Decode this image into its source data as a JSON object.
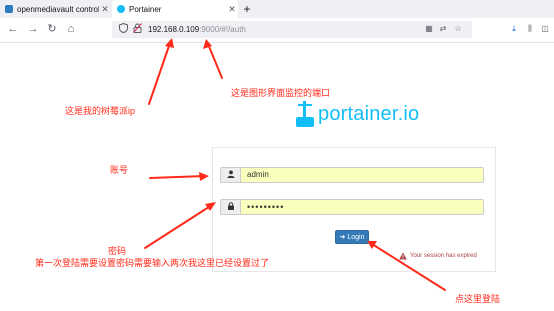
{
  "browser": {
    "tabs": [
      {
        "title": "openmediavault control pan",
        "active": false,
        "close": "✕"
      },
      {
        "title": "Portainer",
        "active": true,
        "close": "✕"
      }
    ],
    "new_tab": "+",
    "nav": {
      "back": "←",
      "forward": "→",
      "reload": "↻",
      "home": "⌂"
    },
    "url": {
      "host": "192.168.0.109",
      "rest": ":9000/#!/auth"
    },
    "right_icons": {
      "qr": "▦",
      "translate": "⇄",
      "bookmark": "☆",
      "download": "⤓",
      "library": "⫼",
      "sidebar": "◫"
    }
  },
  "logo": {
    "text": "portainer.io"
  },
  "login": {
    "username_icon": "👤",
    "username_value": "admin",
    "password_icon": "🔒",
    "password_value": "•••••••••",
    "login_icon": "➜",
    "login_label": "Login",
    "warning_icon": "▲",
    "expired_message": "Your session has expired"
  },
  "annotations": {
    "pi_ip": "这是我的树莓派ip",
    "port": "这是图形界面监控的端口",
    "account": "账号",
    "password": "密码",
    "first_login": "第一次登陆需要设置密码需要输入两次我这里已经设置过了",
    "click_login": "点这里登陆"
  },
  "colors": {
    "annotation": "#ff2a1a",
    "brand": "#13bef9",
    "button": "#337ab7",
    "autofill": "#faffbd",
    "error": "#a94442"
  }
}
